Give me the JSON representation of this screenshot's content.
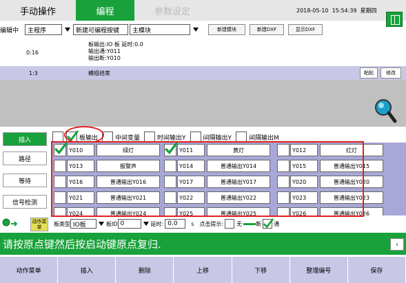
{
  "tabs": {
    "manual": "手动操作",
    "program": "编程",
    "params": "参数设定"
  },
  "header": {
    "date": "2018-05-10",
    "time": "15:54:39",
    "weekday": "星期四"
  },
  "editbar": {
    "mode_label": "编辑中",
    "program_select": "主程序",
    "new_button_label": "新建可编程按键",
    "module_select": "主模块",
    "new_module": "新建模块",
    "new_dxf": "新建DXF",
    "show_dxf": "显示DXF"
  },
  "program_lines": [
    {
      "num": "0:16",
      "text": "板输出:IO 板 延时:0.0\n输出通:Y011\n输出断:Y010"
    }
  ],
  "selected_line": {
    "num": "1:3",
    "text": "模组结束",
    "paste": "粘贴",
    "modify": "修改"
  },
  "sidebar": {
    "insert": "插入",
    "path": "路径",
    "wait": "等待",
    "signal": "信号检测",
    "action_menu": "动作菜单"
  },
  "type_options": [
    "板输出",
    "中间变量",
    "时间输出Y",
    "间隔输出Y",
    "间隔输出M"
  ],
  "outputs": [
    {
      "code": "Y010",
      "name": "绿灯",
      "checked": true
    },
    {
      "code": "Y011",
      "name": "黄灯",
      "checked": true
    },
    {
      "code": "Y012",
      "name": "红灯",
      "checked": false
    },
    {
      "code": "Y013",
      "name": "报警声",
      "checked": false
    },
    {
      "code": "Y014",
      "name": "普通输出Y014",
      "checked": false
    },
    {
      "code": "Y015",
      "name": "普通输出Y015",
      "checked": false
    },
    {
      "code": "Y016",
      "name": "普通输出Y016",
      "checked": false
    },
    {
      "code": "Y017",
      "name": "普通输出Y017",
      "checked": false
    },
    {
      "code": "Y020",
      "name": "普通输出Y020",
      "checked": false
    },
    {
      "code": "Y021",
      "name": "普通输出Y021",
      "checked": false
    },
    {
      "code": "Y022",
      "name": "普通输出Y022",
      "checked": false
    },
    {
      "code": "Y023",
      "name": "普通输出Y023",
      "checked": false
    },
    {
      "code": "Y024",
      "name": "普通输出Y024",
      "checked": false
    },
    {
      "code": "Y025",
      "name": "普通输出Y025",
      "checked": false
    },
    {
      "code": "Y026",
      "name": "普通输出Y026",
      "checked": false
    }
  ],
  "bottom_controls": {
    "board_type_label": "板类型",
    "board_type": "IO板",
    "board_id_label": "板ID",
    "board_id": "0",
    "delay_label": "延时:",
    "delay": "0.0",
    "unit": "s",
    "hint_label": "点击提示:",
    "hint_value": "无",
    "off_label": "断",
    "on_label": "通"
  },
  "status_message": "请按原点键然后按启动键原点复归.",
  "footer": [
    "动作菜单",
    "插入",
    "删除",
    "上移",
    "下移",
    "整理编号",
    "保存"
  ]
}
